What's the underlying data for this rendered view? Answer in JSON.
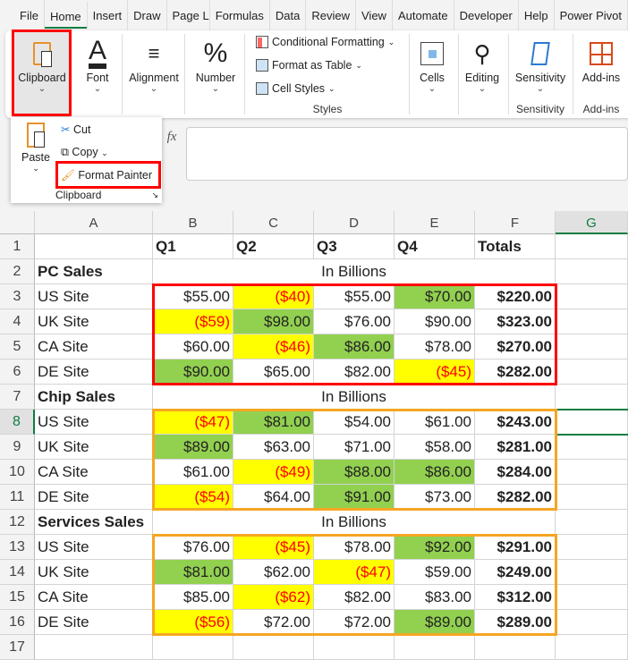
{
  "tabs": [
    "File",
    "Home",
    "Insert",
    "Draw",
    "Page Layout",
    "Formulas",
    "Data",
    "Review",
    "View",
    "Automate",
    "Developer",
    "Help",
    "Power Pivot"
  ],
  "active_tab": "Home",
  "ribbon": {
    "clipboard": "Clipboard",
    "font": "Font",
    "alignment": "Alignment",
    "number": "Number",
    "conditional_formatting": "Conditional Formatting",
    "format_as_table": "Format as Table",
    "cell_styles": "Cell Styles",
    "styles_group": "Styles",
    "cells": "Cells",
    "editing": "Editing",
    "sensitivity": "Sensitivity",
    "sensitivity_group": "Sensitivity",
    "addins": "Add-ins",
    "addins_group": "Add-ins"
  },
  "clipboard_popup": {
    "paste": "Paste",
    "cut": "Cut",
    "copy": "Copy",
    "format_painter": "Format Painter",
    "group": "Clipboard"
  },
  "formula_bar": {
    "fx": "fx",
    "value": ""
  },
  "columns": [
    "A",
    "B",
    "C",
    "D",
    "E",
    "F",
    "G"
  ],
  "selected_cell": "G8",
  "colors": {
    "yellow": "#ffff00",
    "green": "#92d050",
    "negative": "#ff0000",
    "highlight_red": "#ff0000",
    "highlight_orange": "#f5a623"
  },
  "rows": [
    {
      "n": "1",
      "a": "",
      "cells": [
        {
          "v": "Q1"
        },
        {
          "v": "Q2"
        },
        {
          "v": "Q3"
        },
        {
          "v": "Q4"
        },
        {
          "v": "Totals"
        }
      ],
      "header": true
    },
    {
      "n": "2",
      "a": "PC Sales",
      "note": "In Billions"
    },
    {
      "n": "3",
      "a": "US Site",
      "cells": [
        {
          "v": "$55.00"
        },
        {
          "v": "($40)",
          "f": "yellow"
        },
        {
          "v": "$55.00"
        },
        {
          "v": "$70.00",
          "f": "green"
        },
        {
          "v": "$220.00"
        }
      ]
    },
    {
      "n": "4",
      "a": "UK Site",
      "cells": [
        {
          "v": "($59)",
          "f": "yellow"
        },
        {
          "v": "$98.00",
          "f": "green"
        },
        {
          "v": "$76.00"
        },
        {
          "v": "$90.00"
        },
        {
          "v": "$323.00"
        }
      ]
    },
    {
      "n": "5",
      "a": "CA Site",
      "cells": [
        {
          "v": "$60.00"
        },
        {
          "v": "($46)",
          "f": "yellow"
        },
        {
          "v": "$86.00",
          "f": "green"
        },
        {
          "v": "$78.00"
        },
        {
          "v": "$270.00"
        }
      ]
    },
    {
      "n": "6",
      "a": "DE Site",
      "cells": [
        {
          "v": "$90.00",
          "f": "green"
        },
        {
          "v": "$65.00"
        },
        {
          "v": "$82.00"
        },
        {
          "v": "($45)",
          "f": "yellow"
        },
        {
          "v": "$282.00"
        }
      ]
    },
    {
      "n": "7",
      "a": "Chip Sales",
      "note": "In Billions"
    },
    {
      "n": "8",
      "a": "US Site",
      "cells": [
        {
          "v": "($47)",
          "f": "yellow"
        },
        {
          "v": "$81.00",
          "f": "green"
        },
        {
          "v": "$54.00"
        },
        {
          "v": "$61.00"
        },
        {
          "v": "$243.00"
        }
      ]
    },
    {
      "n": "9",
      "a": "UK Site",
      "cells": [
        {
          "v": "$89.00",
          "f": "green"
        },
        {
          "v": "$63.00"
        },
        {
          "v": "$71.00"
        },
        {
          "v": "$58.00"
        },
        {
          "v": "$281.00"
        }
      ]
    },
    {
      "n": "10",
      "a": "CA Site",
      "cells": [
        {
          "v": "$61.00"
        },
        {
          "v": "($49)",
          "f": "yellow"
        },
        {
          "v": "$88.00",
          "f": "green"
        },
        {
          "v": "$86.00",
          "f": "green"
        },
        {
          "v": "$284.00"
        }
      ]
    },
    {
      "n": "11",
      "a": "DE Site",
      "cells": [
        {
          "v": "($54)",
          "f": "yellow"
        },
        {
          "v": "$64.00"
        },
        {
          "v": "$91.00",
          "f": "green"
        },
        {
          "v": "$73.00"
        },
        {
          "v": "$282.00"
        }
      ]
    },
    {
      "n": "12",
      "a": "Services Sales",
      "note": "In Billions"
    },
    {
      "n": "13",
      "a": "US Site",
      "cells": [
        {
          "v": "$76.00"
        },
        {
          "v": "($45)",
          "f": "yellow"
        },
        {
          "v": "$78.00"
        },
        {
          "v": "$92.00",
          "f": "green"
        },
        {
          "v": "$291.00"
        }
      ]
    },
    {
      "n": "14",
      "a": "UK Site",
      "cells": [
        {
          "v": "$81.00",
          "f": "green"
        },
        {
          "v": "$62.00"
        },
        {
          "v": "($47)",
          "f": "yellow"
        },
        {
          "v": "$59.00"
        },
        {
          "v": "$249.00"
        }
      ]
    },
    {
      "n": "15",
      "a": "CA Site",
      "cells": [
        {
          "v": "$85.00"
        },
        {
          "v": "($62)",
          "f": "yellow"
        },
        {
          "v": "$82.00"
        },
        {
          "v": "$83.00"
        },
        {
          "v": "$312.00"
        }
      ]
    },
    {
      "n": "16",
      "a": "DE Site",
      "cells": [
        {
          "v": "($56)",
          "f": "yellow"
        },
        {
          "v": "$72.00"
        },
        {
          "v": "$72.00"
        },
        {
          "v": "$89.00",
          "f": "green"
        },
        {
          "v": "$289.00"
        }
      ]
    },
    {
      "n": "17",
      "a": ""
    }
  ]
}
